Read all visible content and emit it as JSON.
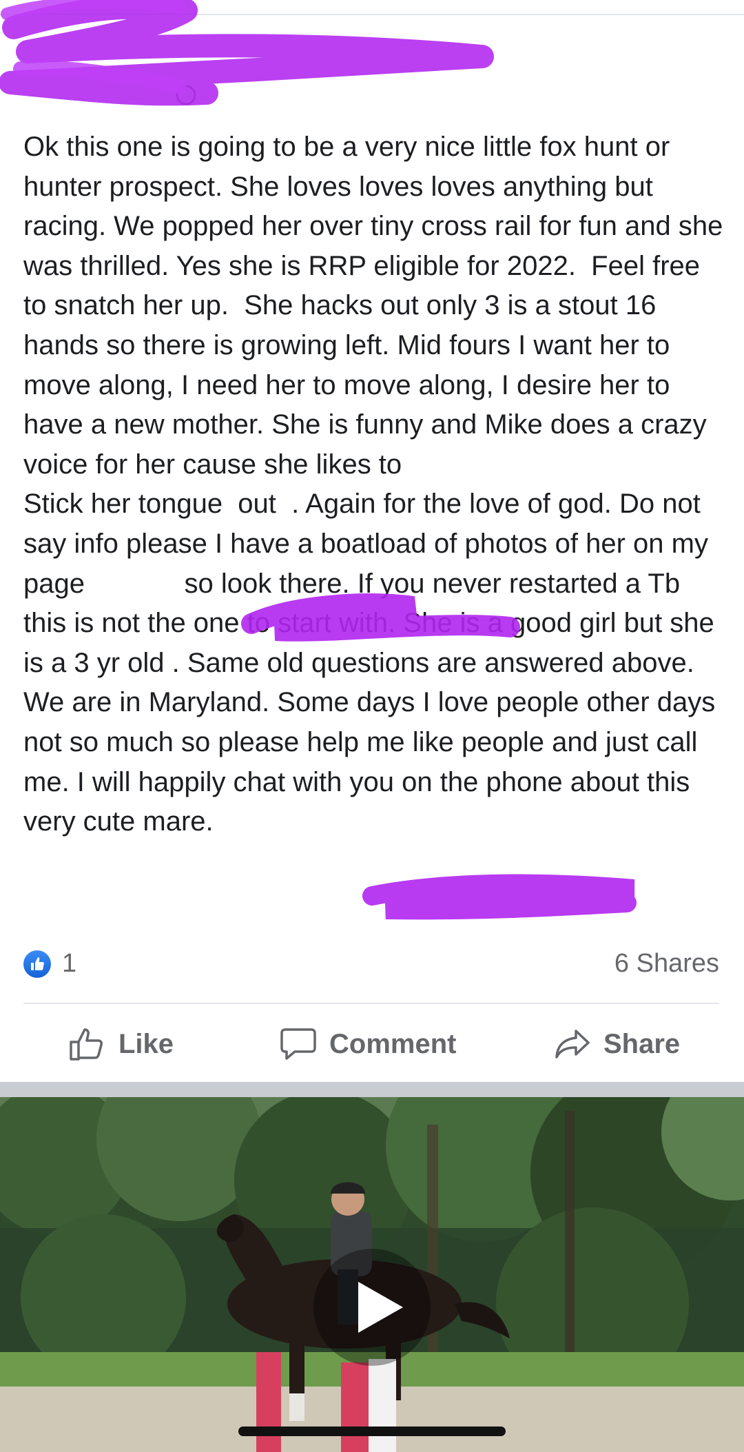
{
  "post": {
    "body": "Ok this one is going to be a very nice little fox hunt or hunter prospect. She loves loves loves anything but racing. We popped her over tiny cross rail for fun and she was thrilled. Yes she is RRP eligible for 2022.  Feel free to snatch her up.  She hacks out only 3 is a stout 16 hands so there is growing left. Mid fours I want her to move along, I need her to move along, I desire her to have a new mother. She is funny and Mike does a crazy voice for her cause she likes to\nStick her tongue  out  . Again for the love of god. Do not say info please I have a boatload of photos of her on my page             so look there. If you never restarted a Tb this is not the one to start with. She is a good girl but she is a 3 yr old . Same old questions are answered above.   We are in Maryland. Some days I love people other days not so much so please help me like people and just call me. I will happily chat with you on the phone about this very cute mare."
  },
  "reactions": {
    "icon": "thumbs-up-icon",
    "count": "1",
    "shares": "6 Shares"
  },
  "actions": {
    "like": "Like",
    "comment": "Comment",
    "share": "Share"
  },
  "video": {
    "icon": "play-icon"
  },
  "colors": {
    "text": "#1c1e21",
    "muted": "#65676b",
    "redaction": "#b026f0",
    "like_blue": "#1877f2"
  }
}
